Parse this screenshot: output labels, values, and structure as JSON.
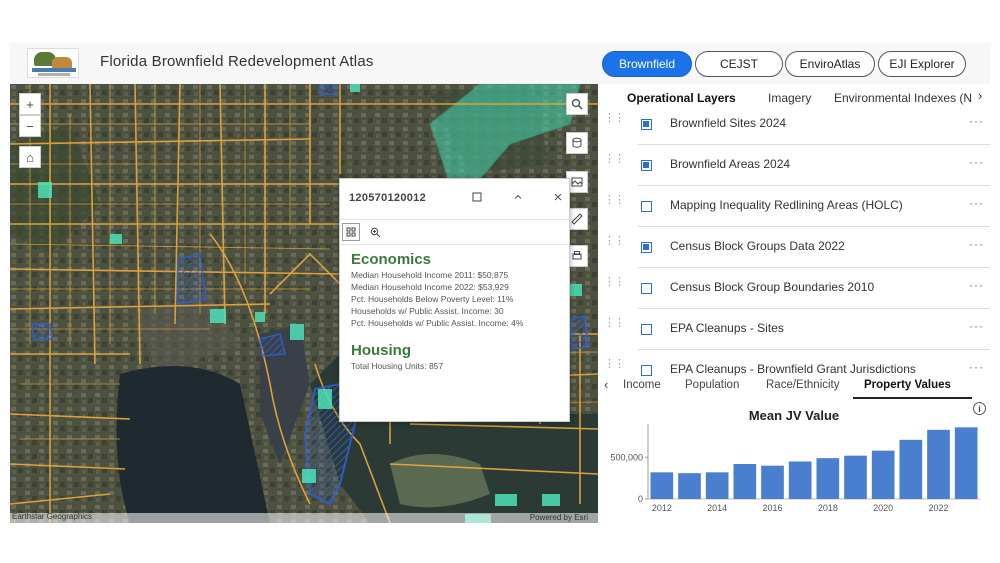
{
  "header": {
    "title": "Florida Brownfield Redevelopment Atlas",
    "tabs": [
      "Brownfield",
      "CEJST",
      "EnviroAtlas",
      "EJI Explorer"
    ],
    "active_tab": "Brownfield"
  },
  "map": {
    "zoom_in": "+",
    "zoom_out": "−",
    "home": "⌂",
    "credit_left": "Earthstar Geographics",
    "credit_right": "Powered by Esri"
  },
  "popup": {
    "title": "120570120012",
    "section1": {
      "heading": "Economics",
      "lines": [
        "Median Household Income 2011: $50,875",
        "Median Household Income 2022: $53,929",
        "Pct. Households Below Poverty Level: 11%",
        "Households w/ Public Assist. Income: 30",
        "Pct. Households w/ Public Assist. Income: 4%"
      ]
    },
    "section2": {
      "heading": "Housing",
      "lines": [
        "Total Housing Units: 857"
      ]
    }
  },
  "panel": {
    "layer_tabs": [
      "Operational Layers",
      "Imagery",
      "Environmental Indexes (N"
    ],
    "layers": [
      {
        "name": "Brownfield Sites 2024",
        "checked": true
      },
      {
        "name": "Brownfield Areas 2024",
        "checked": true
      },
      {
        "name": "Mapping Inequality Redlining Areas (HOLC)",
        "checked": false
      },
      {
        "name": "Census Block Groups Data 2022",
        "checked": true
      },
      {
        "name": "Census Block Group Boundaries 2010",
        "checked": false
      },
      {
        "name": "EPA Cleanups - Sites",
        "checked": false
      },
      {
        "name": "EPA Cleanups - Brownfield Grant Jurisdictions",
        "checked": false
      }
    ],
    "more_label": "···",
    "chart_tabs": [
      "Income",
      "Population",
      "Race/Ethnicity",
      "Property Values"
    ],
    "active_chart_tab": "Property Values"
  },
  "chart_data": {
    "type": "bar",
    "title": "Mean JV Value",
    "categories": [
      "2012",
      "2013",
      "2014",
      "2015",
      "2016",
      "2017",
      "2018",
      "2019",
      "2020",
      "2021",
      "2022",
      "2023"
    ],
    "values": [
      320000,
      310000,
      320000,
      420000,
      400000,
      450000,
      490000,
      520000,
      580000,
      710000,
      830000,
      860000
    ],
    "x_tick_labels": [
      "2012",
      "2014",
      "2016",
      "2018",
      "2020",
      "2022"
    ],
    "y_tick_labels": [
      "0",
      "500,000"
    ],
    "ylim": [
      0,
      900000
    ],
    "bar_color": "#4a7fd0"
  }
}
